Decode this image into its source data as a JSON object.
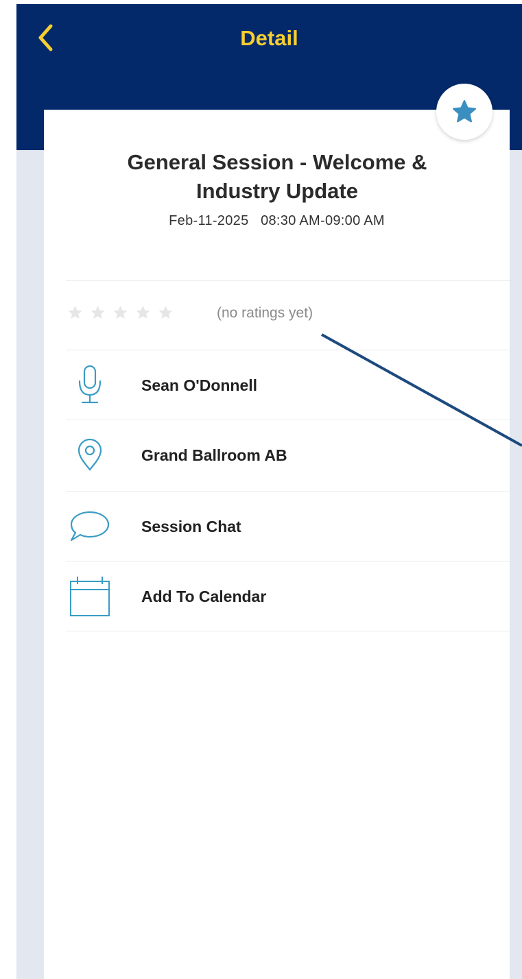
{
  "header": {
    "title": "Detail",
    "back_icon": "chevron-left-icon",
    "background_color": "#03296b",
    "title_color": "#f7cf2e"
  },
  "session": {
    "title": "General Session - Welcome & Industry Update",
    "date": "Feb-11-2025",
    "time": "08:30 AM-09:00 AM",
    "favorite_icon": "star-icon"
  },
  "rating": {
    "stars_filled": 0,
    "stars_total": 5,
    "text": "(no ratings yet)"
  },
  "details": [
    {
      "icon": "microphone-icon",
      "label": "Sean O'Donnell"
    },
    {
      "icon": "location-pin-icon",
      "label": "Grand Ballroom AB"
    },
    {
      "icon": "chat-bubble-icon",
      "label": "Session Chat"
    },
    {
      "icon": "calendar-icon",
      "label": "Add To Calendar"
    }
  ],
  "accent_color": "#3a9cc4"
}
